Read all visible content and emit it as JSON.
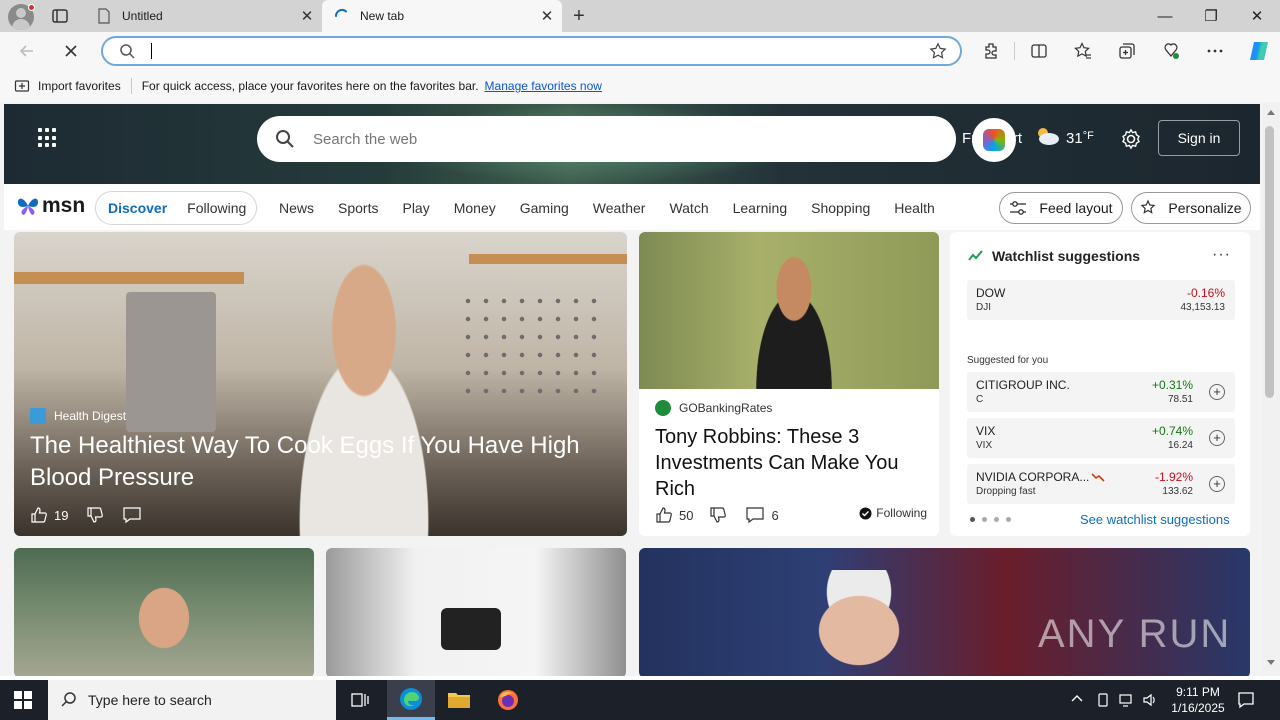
{
  "browser": {
    "tabs": [
      {
        "label": "Untitled",
        "close": "✕"
      },
      {
        "label": "New tab",
        "close": "✕"
      }
    ],
    "new_tab": "+",
    "window": {
      "minimize": "—",
      "maximize": "❐",
      "close": "✕"
    },
    "address": {
      "value": "",
      "placeholder": ""
    }
  },
  "favorites_bar": {
    "import_label": "Import favorites",
    "hint": "For quick access, place your favorites here on the favorites bar.",
    "manage_link": "Manage favorites now"
  },
  "msn": {
    "search_placeholder": "Search the web",
    "city": "Frankfurt",
    "temperature": "31",
    "temp_unit": "°F",
    "sign_in": "Sign in",
    "logo": "msn",
    "feed_toggle": {
      "discover": "Discover",
      "following": "Following"
    },
    "categories": [
      "News",
      "Sports",
      "Play",
      "Money",
      "Gaming",
      "Weather",
      "Watch",
      "Learning",
      "Shopping",
      "Health"
    ],
    "feed_layout": "Feed layout",
    "personalize": "Personalize"
  },
  "cards": {
    "main": {
      "source": "Health Digest",
      "title": "The Healthiest Way To Cook Eggs If You Have High Blood Pressure",
      "likes": "19"
    },
    "secondary": {
      "source": "GOBankingRates",
      "title": "Tony Robbins: These 3 Investments Can Make You Rich",
      "likes": "50",
      "comments": "6",
      "following": "Following"
    }
  },
  "watchlist": {
    "title": "Watchlist suggestions",
    "more": "···",
    "main_stock": {
      "name": "DOW",
      "ticker": "DJI",
      "change": "-0.16%",
      "price": "43,153.13"
    },
    "suggested_label": "Suggested for you",
    "suggestions": [
      {
        "name": "CITIGROUP INC.",
        "ticker": "C",
        "change": "+0.31%",
        "price": "78.51",
        "direction": "up"
      },
      {
        "name": "VIX",
        "ticker": "VIX",
        "change": "+0.74%",
        "price": "16.24",
        "direction": "up"
      },
      {
        "name": "NVIDIA CORPORA...",
        "ticker": "Dropping fast",
        "change": "-1.92%",
        "price": "133.62",
        "direction": "down"
      }
    ],
    "see_link": "See watchlist suggestions"
  },
  "watermark": "ANY RUN",
  "taskbar": {
    "search_placeholder": "Type here to search",
    "time": "9:11 PM",
    "date": "1/16/2025"
  },
  "colors": {
    "accent": "#0f6cbd",
    "negative": "#c50f1f",
    "positive": "#0e7a0d",
    "taskbar": "#1c2029"
  }
}
